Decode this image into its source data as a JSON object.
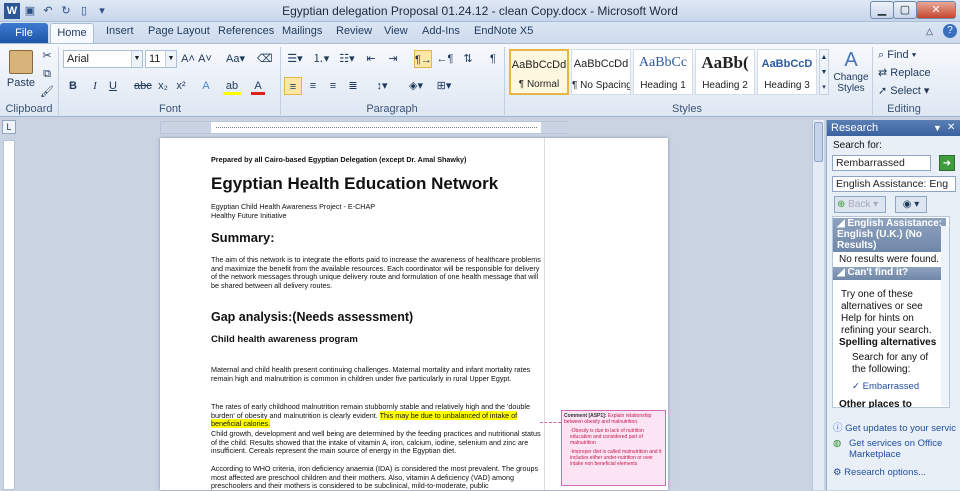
{
  "window": {
    "title": "Egyptian delegation Proposal 01.24.12 - clean Copy.docx  -  Microsoft Word"
  },
  "qat": {
    "icons": [
      "word-app-icon",
      "save-icon",
      "undo-icon",
      "redo-icon",
      "new-document-icon",
      "customize-icon"
    ]
  },
  "tabs": [
    "File",
    "Home",
    "Insert",
    "Page Layout",
    "References",
    "Mailings",
    "Review",
    "View",
    "Add-Ins",
    "EndNote X5"
  ],
  "ribbon": {
    "clipboard": {
      "label": "Clipboard",
      "paste": "Paste"
    },
    "font": {
      "label": "Font",
      "family": "Arial",
      "size": "11"
    },
    "paragraph": {
      "label": "Paragraph"
    },
    "styles": {
      "label": "Styles",
      "items": [
        {
          "preview": "AaBbCcDd",
          "name": "¶ Normal"
        },
        {
          "preview": "AaBbCcDd",
          "name": "¶ No Spacing"
        },
        {
          "preview": "AaBbCc",
          "name": "Heading 1"
        },
        {
          "preview": "AaBb(",
          "name": "Heading 2"
        },
        {
          "preview": "AaBbCcD",
          "name": "Heading 3"
        }
      ],
      "change_styles": "Change Styles"
    },
    "editing": {
      "label": "Editing",
      "find": "Find",
      "replace": "Replace",
      "select": "Select"
    }
  },
  "document": {
    "line1": "Prepared by all Cairo-based Egyptian Delegation (except Dr. Amal Shawky)",
    "title": "Egyptian Health Education Network",
    "sub1": "Egyptian Child Health Awareness Project - E-CHAP",
    "sub2": "Healthy Future Initiative",
    "h_summary": "Summary:",
    "summary_p": "The aim of this network is to integrate the efforts paid to increase the awareness of healthcare problems and maximize the benefit from the available resources. Each coordinator will be responsible for delivery of the network messages through unique delivery route and formulation of one health message that will be shared between all delivery routes.",
    "h_gap": "Gap analysis:(Needs assessment)",
    "h_child": "Child health awareness program",
    "p1": "Maternal and child health present continuing challenges. Maternal mortality and infant mortality rates remain high and malnutrition is common in children under five particularly in rural Upper Egypt.",
    "p2a": "The rates of early childhood malnutrition remain stubbornly stable and relatively high and the 'double burden' of obesity and malnutrition is clearly evident.",
    "p2b": "This may be due to unbalanced of intake of beneficial calories.",
    "p3": "Child growth, development and well being are determined by the feeding practices and nutritional status of the child. Results showed that the intake of vitamin A, iron, calcium, iodine, selenium and zinc are insufficient. Cereals represent the main source of energy in the Egyptian diet.",
    "p4": "According to WHO criteria, iron deficiency anaemia (IDA) is considered the most prevalent. The groups most affected are preschool children and their mothers. Also, vitamin A deficiency (VAD) among preschoolers and their mothers is considered to be subclinical, mild-to-moderate, public"
  },
  "comment": {
    "head": "Comment [ASP1]:",
    "text": "Explain relationship between obesity and malnutrition.",
    "b1": "-Obesity is due to lack of nutrition education and considered part of malnutrition",
    "b2": "-Improper diet is called malnutrition and it includes either under-nutrition or over intake non beneficial elements"
  },
  "research": {
    "title": "Research",
    "search_for": "Search for:",
    "query": "Rembarrassed",
    "source": "English Assistance: Eng",
    "back": "Back",
    "sec1": "English Assistance: English (U.K.) (No Results)",
    "no_results": "No results were found.",
    "sec2": "Can't find it?",
    "try": "Try one of these alternatives or see Help for hints on refining your search.",
    "spelling": "Spelling alternatives",
    "search_any": "Search for any of the following:",
    "suggestion": "Embarrassed",
    "other": "Other places to",
    "updates": "Get updates to your servic",
    "services": "Get services on Office Marketplace",
    "options": "Research options..."
  }
}
